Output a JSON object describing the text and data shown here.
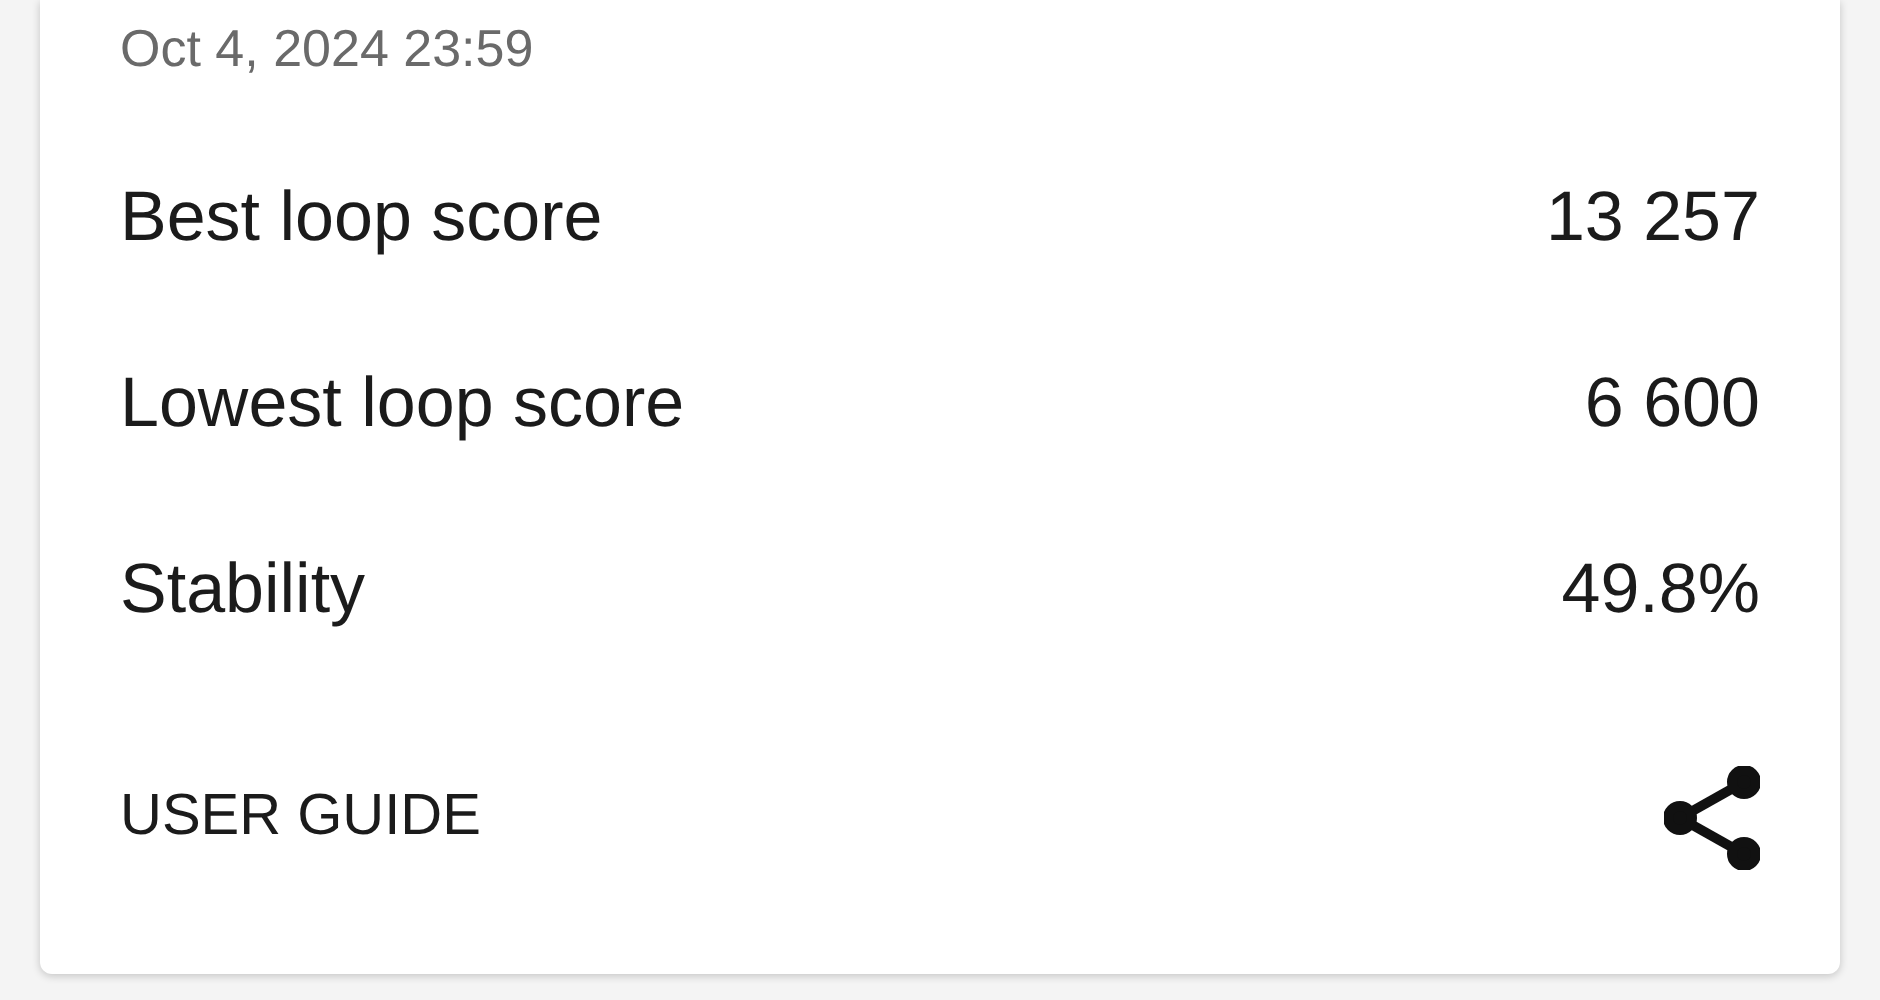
{
  "date": "Oct 4, 2024 23:59",
  "stats": [
    {
      "label": "Best loop score",
      "value": "13 257"
    },
    {
      "label": "Lowest loop score",
      "value": "6 600"
    },
    {
      "label": "Stability",
      "value": "49.8%"
    }
  ],
  "footer": {
    "link": "USER GUIDE"
  }
}
